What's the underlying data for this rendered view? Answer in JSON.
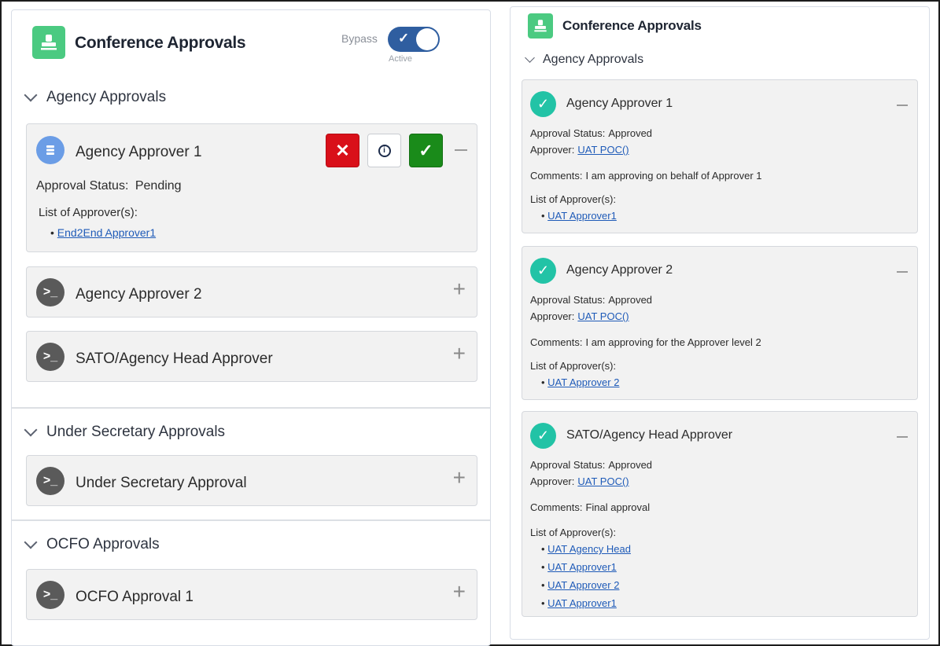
{
  "left": {
    "title": "Conference Approvals",
    "bypass_label": "Bypass",
    "toggle_state": "Active",
    "sections": {
      "agency": {
        "label": "Agency Approvals",
        "card1": {
          "title": "Agency Approver 1",
          "status_label": "Approval Status:",
          "status_value": "Pending",
          "list_label": "List of Approver(s):",
          "approvers": [
            "End2End Approver1"
          ],
          "reject_icon": "x-icon",
          "info_icon": "info-icon",
          "approve_icon": "check-icon"
        },
        "card2": {
          "title": "Agency Approver 2"
        },
        "card3": {
          "title": "SATO/Agency Head Approver"
        }
      },
      "under_secretary": {
        "label": "Under Secretary Approvals",
        "card1": {
          "title": "Under Secretary Approval"
        }
      },
      "ocfo": {
        "label": "OCFO Approvals",
        "card1": {
          "title": "OCFO Approval 1"
        }
      }
    }
  },
  "right": {
    "title": "Conference Approvals",
    "section_label": "Agency Approvals",
    "cards": [
      {
        "title": "Agency Approver 1",
        "status_label": "Approval Status:",
        "status_value": "Approved",
        "approver_label": "Approver:",
        "approver_value": "UAT POC()",
        "comments_label": "Comments:",
        "comments_value": "I am approving on behalf of Approver 1",
        "list_label": "List of Approver(s):",
        "approvers": [
          "UAT Approver1"
        ]
      },
      {
        "title": "Agency Approver 2",
        "status_label": "Approval Status:",
        "status_value": "Approved",
        "approver_label": "Approver:",
        "approver_value": "UAT POC()",
        "comments_label": "Comments:",
        "comments_value": "I am approving for the Approver level 2",
        "list_label": "List of Approver(s):",
        "approvers": [
          "UAT Approver 2"
        ]
      },
      {
        "title": "SATO/Agency Head Approver",
        "status_label": "Approval Status:",
        "status_value": "Approved",
        "approver_label": "Approver:",
        "approver_value": "UAT POC()",
        "comments_label": "Comments:",
        "comments_value": "Final approval",
        "list_label": "List of Approver(s):",
        "approvers": [
          "UAT Agency Head",
          "UAT Approver1",
          "UAT Approver 2",
          "UAT Approver1"
        ]
      }
    ]
  },
  "colors": {
    "app_icon": "#4bca81",
    "toggle": "#2f5ea0",
    "reject": "#d9101a",
    "approve": "#1a8b1a",
    "approved_badge": "#22c3a6",
    "link": "#1f5bb8"
  }
}
